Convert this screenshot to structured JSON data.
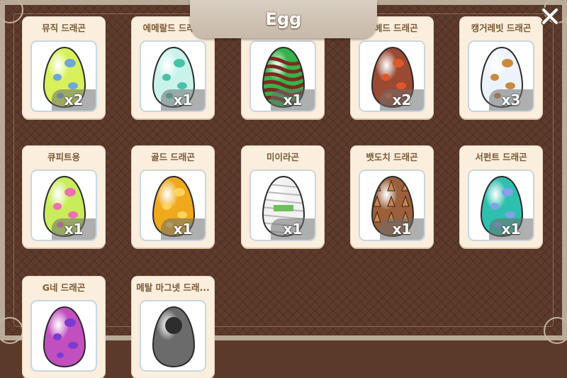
{
  "title": "Egg",
  "close_icon": "close-icon",
  "eggs": [
    {
      "name": "뮤직 드래곤",
      "count": "x2",
      "base": "#d8f05a",
      "spot": "#6fa7d8"
    },
    {
      "name": "에메랄드 드래곤",
      "count": "x1",
      "base": "#c9f3ea",
      "spot": "#48c1a8"
    },
    {
      "name": "",
      "count": "x1",
      "base": "#37b24a",
      "spot": "#7a2b1e",
      "pattern": "stripes"
    },
    {
      "name": "킨헤드 드래곤",
      "count": "x2",
      "base": "#9a4a32",
      "spot": "#e0572a"
    },
    {
      "name": "캥거레빗 드래곤",
      "count": "x3",
      "base": "#eef3fb",
      "spot": "#c98a3f"
    },
    {
      "name": "큐피트용",
      "count": "x1",
      "base": "#c8ec5a",
      "spot": "#ef6fb0"
    },
    {
      "name": "골드 드래곤",
      "count": "x1",
      "base": "#f0a91c",
      "spot": "#ffd35a"
    },
    {
      "name": "미이라곤",
      "count": "x1",
      "base": "#f2f2f2",
      "spot": "#6fbf5a",
      "pattern": "mummy"
    },
    {
      "name": "뱃도치 드래곤",
      "count": "x1",
      "base": "#9b5f3b",
      "spot": "#c4874f",
      "pattern": "spikes"
    },
    {
      "name": "서펀트 드래곤",
      "count": "x1",
      "base": "#2fbfae",
      "spot": "#7fa2e8"
    },
    {
      "name": "G네 드래곤",
      "count": "",
      "base": "#c24fbf",
      "spot": "#7a3ccf"
    },
    {
      "name": "메탈 마그넷 드래...",
      "count": "",
      "base": "#6b6b6b",
      "spot": "#2d2d2d",
      "pattern": "metal"
    }
  ]
}
